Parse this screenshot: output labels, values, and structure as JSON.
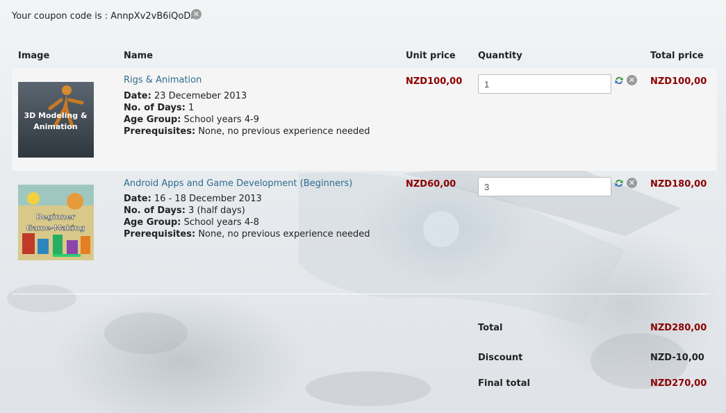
{
  "coupon": {
    "label": "Your coupon code is :",
    "code": "AnnpXv2vB6iQoDm",
    "remove_icon": "close-icon"
  },
  "table": {
    "headers": {
      "image": "Image",
      "name": "Name",
      "unit_price": "Unit price",
      "quantity": "Quantity",
      "total_price": "Total price"
    },
    "items": [
      {
        "thumb_text": "3D Modeling & Animation",
        "name": "Rigs & Animation",
        "date_label": "Date:",
        "date": "23 Decemeber 2013",
        "days_label": "No. of Days:",
        "days": "1",
        "age_label": "Age Group:",
        "age": "School years 4-9",
        "prereq_label": "Prerequisites:",
        "prereq": "None, no previous experience needed",
        "unit_price": "NZD100,00",
        "quantity": "1",
        "total_price": "NZD100,00"
      },
      {
        "thumb_text": "Beginner Game-Making",
        "name": "Android Apps and Game Development (Beginners)",
        "date_label": "Date:",
        "date": "16 - 18 December 2013",
        "days_label": "No. of Days:",
        "days": "3 (half days)",
        "age_label": "Age Group:",
        "age": "School years 4-8",
        "prereq_label": "Prerequisites:",
        "prereq": "None, no previous experience needed",
        "unit_price": "NZD60,00",
        "quantity": "3",
        "total_price": "NZD180,00"
      }
    ]
  },
  "summary": {
    "total_label": "Total",
    "total_value": "NZD280,00",
    "discount_label": "Discount",
    "discount_value": "NZD-10,00",
    "final_label": "Final total",
    "final_value": "NZD270,00"
  },
  "colors": {
    "price_red": "#8b0000",
    "link_blue": "#2e6b8f",
    "row_highlight": "#f5f5f5"
  }
}
